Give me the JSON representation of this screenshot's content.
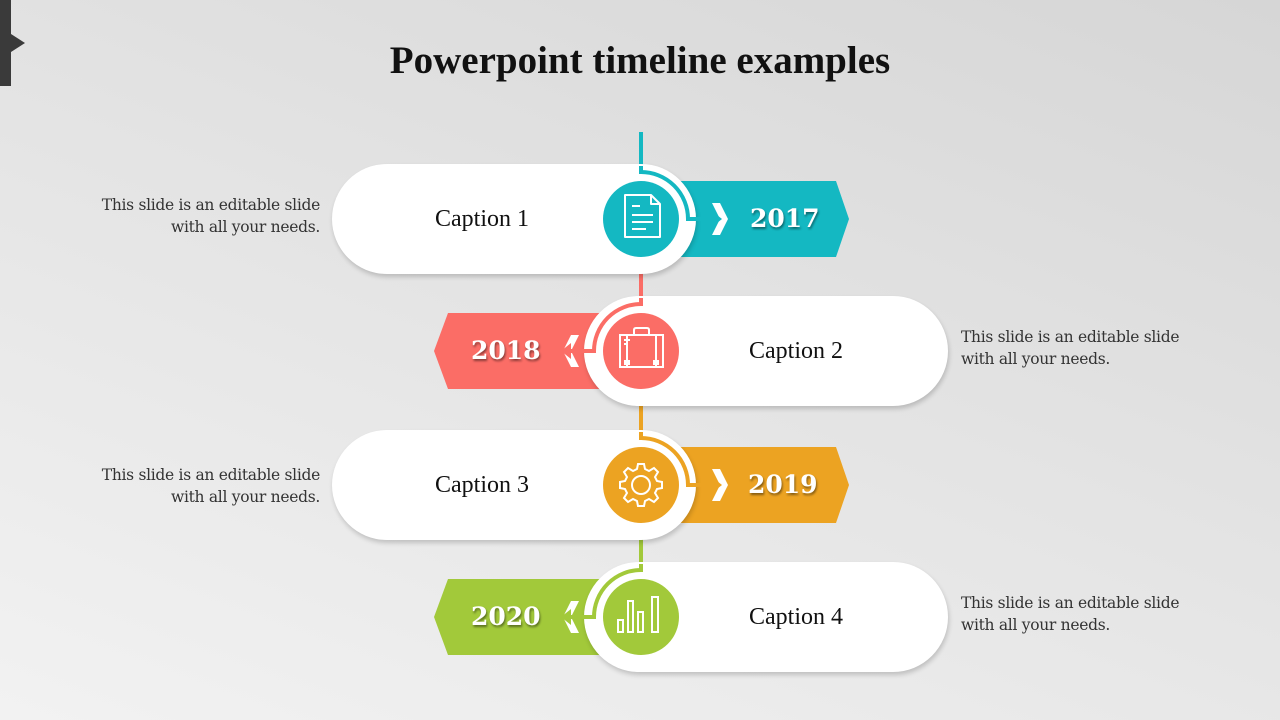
{
  "slide": {
    "title": "Powerpoint timeline examples"
  },
  "colors": {
    "teal": "#14b8c2",
    "coral": "#fb6d66",
    "orange": "#eca322",
    "green": "#a2c93a"
  },
  "timeline": [
    {
      "caption": "Caption 1",
      "year": "2017",
      "description_line1": "This slide is an editable slide",
      "description_line2": "with all your needs.",
      "icon": "document-icon",
      "color": "#14b8c2"
    },
    {
      "caption": "Caption 2",
      "year": "2018",
      "description_line1": "This slide is an editable slide",
      "description_line2": "with all your needs.",
      "icon": "briefcase-icon",
      "color": "#fb6d66"
    },
    {
      "caption": "Caption 3",
      "year": "2019",
      "description_line1": "This slide is an editable slide",
      "description_line2": "with all your needs.",
      "icon": "gear-icon",
      "color": "#eca322"
    },
    {
      "caption": "Caption 4",
      "year": "2020",
      "description_line1": "This slide is an editable slide",
      "description_line2": "with all your needs.",
      "icon": "bar-chart-icon",
      "color": "#a2c93a"
    }
  ]
}
